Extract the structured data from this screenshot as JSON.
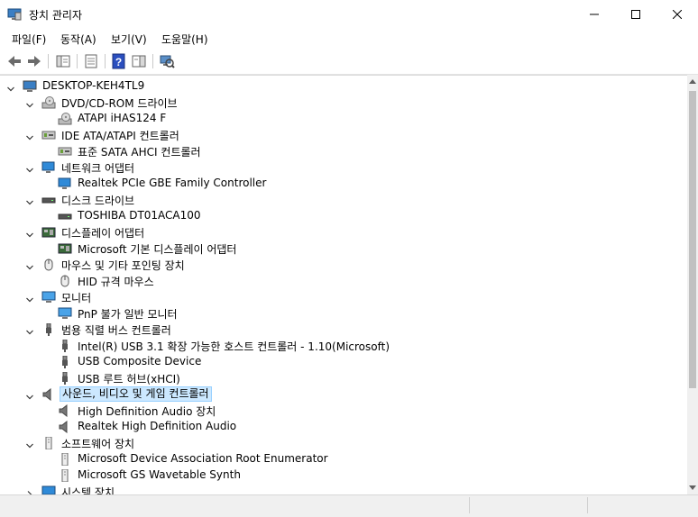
{
  "window": {
    "title": "장치 관리자",
    "minimize": "─",
    "maximize": "☐",
    "close": "✕"
  },
  "menu": [
    "파일(F)",
    "동작(A)",
    "보기(V)",
    "도움말(H)"
  ],
  "tree": {
    "root": "DESKTOP-KEH4TL9",
    "categories": [
      {
        "label": "DVD/CD-ROM 드라이브",
        "icon": "dvd-drive-icon",
        "devices": [
          {
            "label": "ATAPI iHAS124   F",
            "icon": "dvd-drive-icon"
          }
        ]
      },
      {
        "label": "IDE ATA/ATAPI 컨트롤러",
        "icon": "ide-controller-icon",
        "devices": [
          {
            "label": "표준 SATA AHCI 컨트롤러",
            "icon": "ide-controller-icon"
          }
        ]
      },
      {
        "label": "네트워크 어댑터",
        "icon": "network-adapter-icon",
        "devices": [
          {
            "label": "Realtek PCIe GBE Family Controller",
            "icon": "network-adapter-icon"
          }
        ]
      },
      {
        "label": "디스크 드라이브",
        "icon": "disk-drive-icon",
        "devices": [
          {
            "label": "TOSHIBA DT01ACA100",
            "icon": "disk-drive-icon"
          }
        ]
      },
      {
        "label": "디스플레이 어댑터",
        "icon": "display-adapter-icon",
        "devices": [
          {
            "label": "Microsoft 기본 디스플레이 어댑터",
            "icon": "display-adapter-icon"
          }
        ]
      },
      {
        "label": "마우스 및 기타 포인팅 장치",
        "icon": "mouse-icon",
        "devices": [
          {
            "label": "HID 규격 마우스",
            "icon": "mouse-icon"
          }
        ]
      },
      {
        "label": "모니터",
        "icon": "monitor-icon",
        "devices": [
          {
            "label": "PnP 불가 일반 모니터",
            "icon": "monitor-icon"
          }
        ]
      },
      {
        "label": "범용 직렬 버스 컨트롤러",
        "icon": "usb-icon",
        "devices": [
          {
            "label": "Intel(R) USB 3.1 확장 가능한 호스트 컨트롤러 - 1.10(Microsoft)",
            "icon": "usb-icon"
          },
          {
            "label": "USB Composite Device",
            "icon": "usb-icon"
          },
          {
            "label": "USB 루트 허브(xHCI)",
            "icon": "usb-icon"
          }
        ]
      },
      {
        "label": "사운드, 비디오 및 게임 컨트롤러",
        "icon": "speaker-icon",
        "selected": true,
        "devices": [
          {
            "label": "High Definition Audio 장치",
            "icon": "speaker-icon"
          },
          {
            "label": "Realtek High Definition Audio",
            "icon": "speaker-icon"
          }
        ]
      },
      {
        "label": "소프트웨어 장치",
        "icon": "software-device-icon",
        "devices": [
          {
            "label": "Microsoft Device Association Root Enumerator",
            "icon": "software-device-icon"
          },
          {
            "label": "Microsoft GS Wavetable Synth",
            "icon": "software-device-icon"
          }
        ]
      },
      {
        "label": "시스템 장치",
        "icon": "system-device-icon",
        "collapsed": true,
        "devices": []
      }
    ]
  },
  "colors": {
    "selection_bg": "#cce8ff",
    "selection_border": "#99d1ff",
    "toolbar_help": "#2b4fbf"
  }
}
